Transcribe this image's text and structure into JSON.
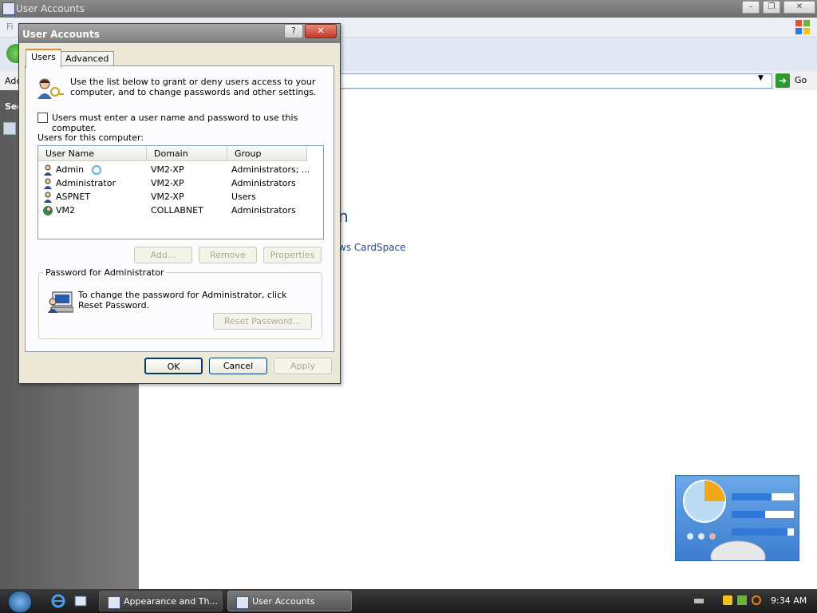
{
  "background_window": {
    "title": "User Accounts",
    "menu_first_letter": "Fi",
    "address_label": "Add",
    "go_label": "Go",
    "side_heading": "See",
    "heading_fragment": "n",
    "link_fragment": "ws CardSpace"
  },
  "dialog": {
    "title": "User Accounts",
    "help_glyph": "?",
    "close_glyph": "✕",
    "tabs": [
      {
        "label": "Users",
        "selected": true
      },
      {
        "label": "Advanced",
        "selected": false
      }
    ],
    "intro_text": "Use the list below to grant or deny users access to your computer, and to change passwords and other settings.",
    "must_enter_label": "Users must enter a user name and password to use this computer.",
    "must_enter_checked": false,
    "users_label": "Users for this computer:",
    "columns": [
      "User Name",
      "Domain",
      "Group"
    ],
    "users": [
      {
        "name": "Admin",
        "domain": "VM2-XP",
        "group": "Administrators; ..."
      },
      {
        "name": "Administrator",
        "domain": "VM2-XP",
        "group": "Administrators"
      },
      {
        "name": "ASPNET",
        "domain": "VM2-XP",
        "group": "Users"
      },
      {
        "name": "VM2",
        "domain": "COLLABNET",
        "group": "Administrators"
      }
    ],
    "buttons": {
      "add": "Add...",
      "remove": "Remove",
      "properties": "Properties",
      "reset_password": "Reset Password...",
      "ok": "OK",
      "cancel": "Cancel",
      "apply": "Apply"
    },
    "password_group": {
      "legend": "Password for Administrator",
      "text": "To change the password for Administrator, click Reset Password."
    }
  },
  "taskbar": {
    "tasks": [
      {
        "label": "Appearance and Th..."
      },
      {
        "label": "User Accounts"
      }
    ],
    "clock": "9:34 AM"
  },
  "colors": {
    "dialog_face": "#ece9d8",
    "link_blue": "#1e4a9a",
    "tab_accent": "#e68b2c"
  }
}
